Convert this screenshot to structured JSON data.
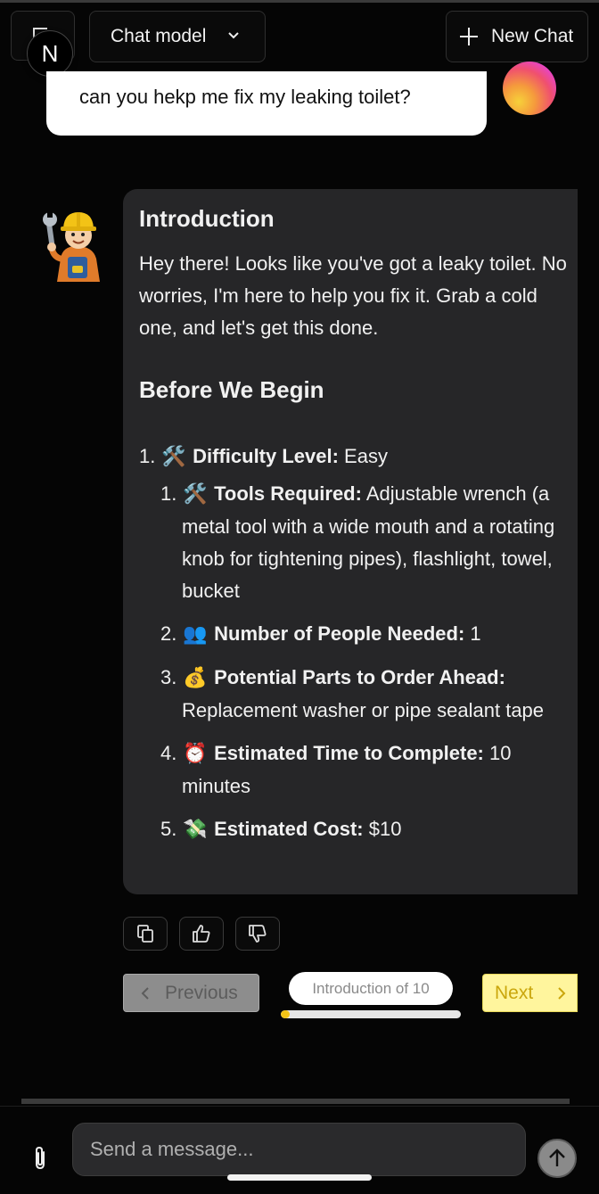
{
  "header": {
    "logo_letter": "N",
    "model_label": "Chat model",
    "new_chat_label": "New Chat"
  },
  "user_message": {
    "text": "can you hekp me fix my leaking toilet?"
  },
  "bot_message": {
    "intro_heading": "Introduction",
    "intro_text": "Hey there! Looks like you've got a leaky toilet. No worries, I'm here to help you fix it. Grab a cold one, and let's get this done.",
    "begin_heading": "Before We Begin",
    "difficulty": {
      "number": "1.",
      "emoji": "🛠️",
      "label": "Difficulty Level:",
      "value": " Easy"
    },
    "items": [
      {
        "number": "1.",
        "emoji": "🛠️",
        "label": "Tools Required:",
        "value": " Adjustable wrench (a metal tool with a wide mouth and a rotating knob for tightening pipes), flashlight, towel, bucket"
      },
      {
        "number": "2.",
        "emoji": "👥",
        "label": "Number of People Needed:",
        "value": " 1"
      },
      {
        "number": "3.",
        "emoji": "💰",
        "label": "Potential Parts to Order Ahead:",
        "value": " Replacement washer or pipe sealant tape"
      },
      {
        "number": "4.",
        "emoji": "⏰",
        "label": "Estimated Time to Complete:",
        "value": " 10 minutes"
      },
      {
        "number": "5.",
        "emoji": "💸",
        "label": "Estimated Cost:",
        "value": " $10"
      }
    ]
  },
  "actions": {
    "copy_icon": "copy-icon",
    "thumbs_up_icon": "thumbs-up-icon",
    "thumbs_down_icon": "thumbs-down-icon"
  },
  "pager": {
    "previous_label": "Previous",
    "progress_label": "Introduction of 10",
    "progress_fraction": 0.05,
    "next_label": "Next"
  },
  "composer": {
    "placeholder": "Send a message...",
    "value": ""
  },
  "colors": {
    "background": "#050505",
    "bubble": "#262628",
    "next_bg": "#fff59d",
    "progress_fill": "#f3c316"
  }
}
